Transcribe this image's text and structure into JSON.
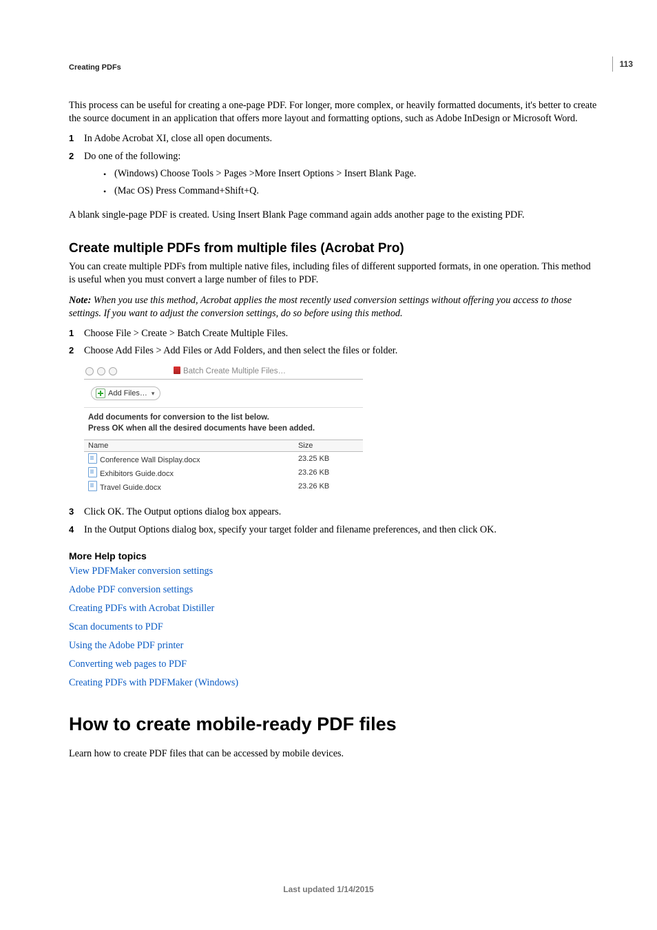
{
  "page_number": "113",
  "running_head": "Creating PDFs",
  "intro_para": "This process can be useful for creating a one-page PDF. For longer, more complex, or heavily formatted documents, it's better to create the source document in an application that offers more layout and formatting options, such as Adobe InDesign or Microsoft Word.",
  "steps_a": {
    "s1_num": "1",
    "s1_txt": "In Adobe Acrobat XI, close all open documents.",
    "s2_num": "2",
    "s2_txt": "Do one of the following:",
    "s2_b1": "(Windows) Choose Tools > Pages >More Insert Options > Insert Blank Page.",
    "s2_b2": "(Mac OS) Press Command+Shift+Q."
  },
  "para_after_a": "A blank single-page PDF is created. Using Insert Blank Page command again adds another page to the existing PDF.",
  "section_heading": "Create multiple PDFs from multiple files (Acrobat Pro)",
  "section_intro": "You can create multiple PDFs from multiple native files, including files of different supported formats, in one operation. This method is useful when you must convert a large number of files to PDF.",
  "note_label": "Note: ",
  "note_body": "When you use this method, Acrobat applies the most recently used conversion settings without offering you access to those settings. If you want to adjust the conversion settings, do so before using this method.",
  "steps_b": {
    "s1_num": "1",
    "s1_txt": "Choose File > Create > Batch Create Multiple Files.",
    "s2_num": "2",
    "s2_txt": "Choose Add Files > Add Files or Add Folders, and then select the files or folder.",
    "s3_num": "3",
    "s3_txt": "Click OK. The Output options dialog box appears.",
    "s4_num": "4",
    "s4_txt": "In the Output Options dialog box, specify your target folder and filename preferences, and then click OK."
  },
  "dialog": {
    "title": "Batch Create Multiple Files…",
    "add_files_label": "Add Files…",
    "instr_l1": "Add documents for conversion to the list below.",
    "instr_l2": "Press OK when all the desired documents have been added.",
    "col_name": "Name",
    "col_size": "Size",
    "rows": [
      {
        "name": "Conference Wall Display.docx",
        "size": "23.25 KB"
      },
      {
        "name": "Exhibitors Guide.docx",
        "size": "23.26 KB"
      },
      {
        "name": "Travel Guide.docx",
        "size": "23.26 KB"
      }
    ]
  },
  "morehelp_heading": "More Help topics",
  "links": {
    "l1": "View PDFMaker conversion settings",
    "l2": "Adobe PDF conversion settings",
    "l3": "Creating PDFs with Acrobat Distiller",
    "l4": "Scan documents to PDF",
    "l5": "Using the Adobe PDF printer",
    "l6": "Converting web pages to PDF",
    "l7": "Creating PDFs with PDFMaker (Windows)"
  },
  "chapter_heading": "How to create mobile-ready PDF files",
  "chapter_intro": "Learn how to create PDF files that can be accessed by mobile devices.",
  "footer": "Last updated 1/14/2015"
}
